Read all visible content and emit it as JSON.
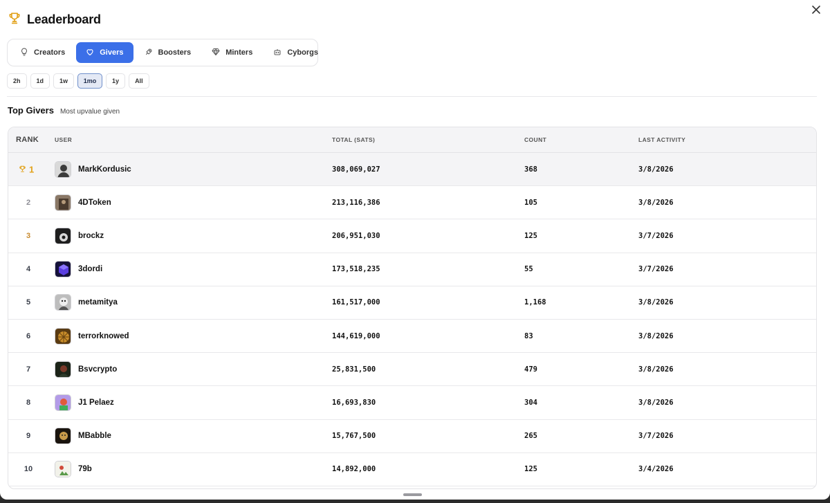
{
  "header": {
    "title": "Leaderboard",
    "icon": "trophy-icon"
  },
  "tabs": [
    {
      "label": "Creators",
      "icon": "lightbulb-icon",
      "active": false
    },
    {
      "label": "Givers",
      "icon": "heart-icon",
      "active": true
    },
    {
      "label": "Boosters",
      "icon": "rocket-icon",
      "active": false
    },
    {
      "label": "Minters",
      "icon": "gem-icon",
      "active": false
    },
    {
      "label": "Cyborgs",
      "icon": "robot-icon",
      "active": false
    }
  ],
  "ranges": [
    {
      "label": "2h",
      "active": false
    },
    {
      "label": "1d",
      "active": false
    },
    {
      "label": "1w",
      "active": false
    },
    {
      "label": "1mo",
      "active": true
    },
    {
      "label": "1y",
      "active": false
    },
    {
      "label": "All",
      "active": false
    }
  ],
  "section": {
    "title": "Top Givers",
    "subtitle": "Most upvalue given"
  },
  "table": {
    "columns": {
      "rank": "RANK",
      "user": "USER",
      "total": "TOTAL (SATS)",
      "count": "COUNT",
      "last": "LAST ACTIVITY"
    },
    "rows": [
      {
        "rank": "1",
        "user": "MarkKordusic",
        "total": "308,069,027",
        "count": "368",
        "last": "3/8/2026",
        "avatar_color": "#3b3b3b"
      },
      {
        "rank": "2",
        "user": "4DToken",
        "total": "213,116,386",
        "count": "105",
        "last": "3/8/2026",
        "avatar_color": "#6b5a4a"
      },
      {
        "rank": "3",
        "user": "brockz",
        "total": "206,951,030",
        "count": "125",
        "last": "3/7/2026",
        "avatar_color": "#1e1e1e"
      },
      {
        "rank": "4",
        "user": "3dordi",
        "total": "173,518,235",
        "count": "55",
        "last": "3/7/2026",
        "avatar_color": "#3b2a9a"
      },
      {
        "rank": "5",
        "user": "metamitya",
        "total": "161,517,000",
        "count": "1,168",
        "last": "3/8/2026",
        "avatar_color": "#777777"
      },
      {
        "rank": "6",
        "user": "terrorknowed",
        "total": "144,619,000",
        "count": "83",
        "last": "3/8/2026",
        "avatar_color": "#9a6a22"
      },
      {
        "rank": "7",
        "user": "Bsvcrypto",
        "total": "25,831,500",
        "count": "479",
        "last": "3/8/2026",
        "avatar_color": "#2e3a2a"
      },
      {
        "rank": "8",
        "user": "J1 Pelaez",
        "total": "16,693,830",
        "count": "304",
        "last": "3/8/2026",
        "avatar_color": "#9a7ad8"
      },
      {
        "rank": "9",
        "user": "MBabble",
        "total": "15,767,500",
        "count": "265",
        "last": "3/7/2026",
        "avatar_color": "#2a2118"
      },
      {
        "rank": "10",
        "user": "79b",
        "total": "14,892,000",
        "count": "125",
        "last": "3/4/2026",
        "avatar_color": "#e6ead8"
      }
    ]
  },
  "colors": {
    "accent": "#3b6fe8",
    "gold": "#e2a21b",
    "bronze": "#c78a2e"
  }
}
